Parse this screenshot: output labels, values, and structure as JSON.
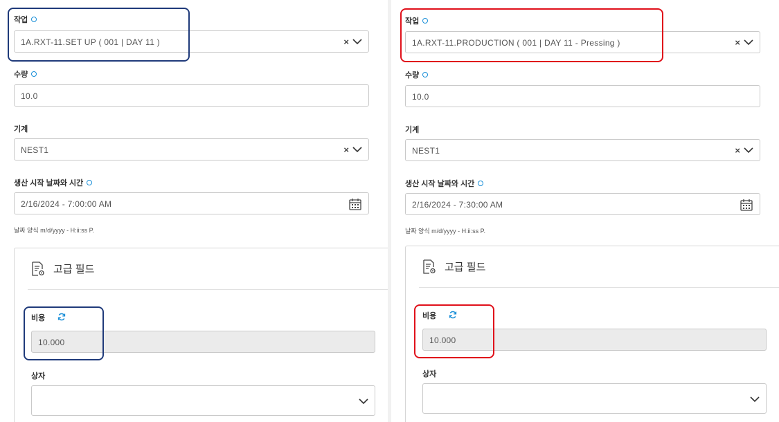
{
  "labels": {
    "task": "작업",
    "quantity": "수량",
    "machine": "기계",
    "start_datetime": "생산 시작 날짜와 시간",
    "date_format_hint": "날짜 양식 m/d/yyyy - H:ii:ss P.",
    "advanced_fields": "고급 필드",
    "cost": "비용",
    "box": "상자"
  },
  "left": {
    "task_value": "1A.RXT-11.SET UP ( 001 | DAY 11 )",
    "quantity_value": "10.0",
    "machine_value": "NEST1",
    "start_datetime_value": "2/16/2024 - 7:00:00 AM",
    "cost_value": "10.000",
    "box_value": ""
  },
  "right": {
    "task_value": "1A.RXT-11.PRODUCTION ( 001 | DAY 11 - Pressing )",
    "quantity_value": "10.0",
    "machine_value": "NEST1",
    "start_datetime_value": "2/16/2024 - 7:30:00 AM",
    "cost_value": "10.000",
    "box_value": ""
  },
  "icons": {
    "clear": "×",
    "dropdown": "chevron-down-icon",
    "calendar": "calendar-icon",
    "advanced": "document-gear-icon",
    "refresh": "refresh-icon"
  },
  "colors": {
    "required_dot": "#1a8fd8",
    "highlight_left": "#1f3a7a",
    "highlight_right": "#e0101a",
    "disabled_bg": "#ebebeb"
  }
}
